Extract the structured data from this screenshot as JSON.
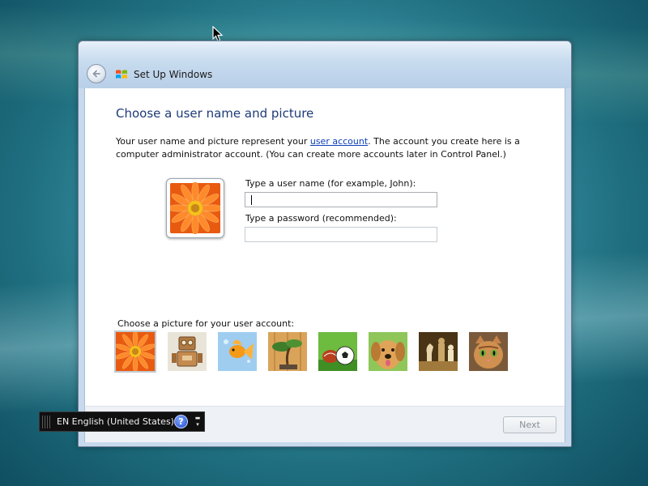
{
  "window": {
    "title": "Set Up Windows",
    "heading": "Choose a user name and picture",
    "description": {
      "before_link": "Your user name and picture represent your ",
      "link": "user account",
      "after_link": ". The account you create here is a computer administrator account. (You can create more accounts later in Control Panel.)"
    },
    "username": {
      "label": "Type a user name (for example, John):",
      "value": ""
    },
    "password": {
      "label": "Type a password (recommended):",
      "value": ""
    },
    "picture_label": "Choose a picture for your user account:",
    "pictures": [
      "flower",
      "robot",
      "fish",
      "bonsai",
      "soccer-ball",
      "dog",
      "chess",
      "kitten"
    ],
    "selected_picture": "flower",
    "next_label": "Next"
  },
  "language_bar": {
    "text": "EN English (United States)",
    "help_label": "?"
  },
  "colors": {
    "heading": "#1e3a78",
    "link": "#0b3fb8",
    "frame": "#c7d9ec"
  }
}
